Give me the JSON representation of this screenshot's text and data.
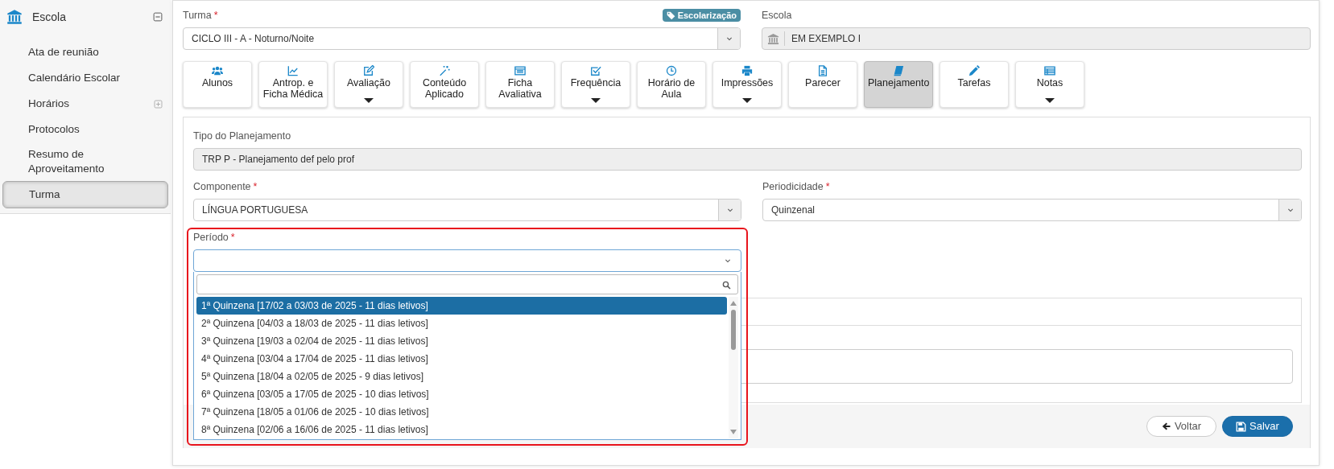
{
  "sidebar": {
    "title": "Escola",
    "expanded": true,
    "items": [
      {
        "label": "Ata de reunião",
        "kind": "link",
        "selected": false
      },
      {
        "label": "Calendário Escolar",
        "kind": "link",
        "selected": false
      },
      {
        "label": "Horários",
        "kind": "group",
        "expanded": false,
        "selected": false
      },
      {
        "label": "Protocolos",
        "kind": "link",
        "selected": false
      },
      {
        "label": "Resumo de Aproveitamento",
        "kind": "link",
        "selected": false
      },
      {
        "label": "Turma",
        "kind": "link",
        "selected": true
      }
    ]
  },
  "turma": {
    "label": "Turma",
    "required_mark": "*",
    "value": "CICLO III - A - Noturno/Noite",
    "badge": "Escolarização"
  },
  "escola": {
    "label": "Escola",
    "value": "EM EXEMPLO I",
    "disabled": true
  },
  "toolbar": [
    {
      "label": "Alunos",
      "dropdown": false,
      "selected": false
    },
    {
      "label": "Antrop. e Ficha Médica",
      "dropdown": false,
      "selected": false
    },
    {
      "label": "Avaliação",
      "dropdown": true,
      "selected": false
    },
    {
      "label": "Conteúdo Aplicado",
      "dropdown": false,
      "selected": false
    },
    {
      "label": "Ficha Avaliativa",
      "dropdown": false,
      "selected": false
    },
    {
      "label": "Frequência",
      "dropdown": true,
      "selected": false
    },
    {
      "label": "Horário de Aula",
      "dropdown": false,
      "selected": false
    },
    {
      "label": "Impressões",
      "dropdown": true,
      "selected": false
    },
    {
      "label": "Parecer",
      "dropdown": false,
      "selected": false
    },
    {
      "label": "Planejamento",
      "dropdown": false,
      "selected": true
    },
    {
      "label": "Tarefas",
      "dropdown": false,
      "selected": false
    },
    {
      "label": "Notas",
      "dropdown": true,
      "selected": false
    }
  ],
  "tipo_planejamento": {
    "label": "Tipo do Planejamento",
    "value": "TRP P - Planejamento def pelo prof",
    "disabled": true
  },
  "componente": {
    "label": "Componente",
    "required_mark": "*",
    "value": "LÍNGUA PORTUGUESA"
  },
  "periodicidade": {
    "label": "Periodicidade",
    "required_mark": "*",
    "value": "Quinzenal"
  },
  "periodo": {
    "label": "Período",
    "required_mark": "*",
    "expanded": true,
    "options": [
      {
        "label": "1ª Quinzena [17/02 a 03/03 de 2025 - 11 dias letivos]",
        "selected": true
      },
      {
        "label": "2ª Quinzena [04/03 a 18/03 de 2025 - 11 dias letivos]",
        "selected": false
      },
      {
        "label": "3ª Quinzena [19/03 a 02/04 de 2025 - 11 dias letivos]",
        "selected": false
      },
      {
        "label": "4ª Quinzena [03/04 a 17/04 de 2025 - 11 dias letivos]",
        "selected": false
      },
      {
        "label": "5ª Quinzena [18/04 a 02/05 de 2025 - 9 dias letivos]",
        "selected": false
      },
      {
        "label": "6ª Quinzena [03/05 a 17/05 de 2025 - 10 dias letivos]",
        "selected": false
      },
      {
        "label": "7ª Quinzena [18/05 a 01/06 de 2025 - 10 dias letivos]",
        "selected": false
      },
      {
        "label": "8ª Quinzena [02/06 a 16/06 de 2025 - 11 dias letivos]",
        "selected": false
      }
    ]
  },
  "buttons": [
    {
      "label": "Voltar",
      "kind": "back"
    },
    {
      "label": "Salvar",
      "kind": "save"
    }
  ]
}
